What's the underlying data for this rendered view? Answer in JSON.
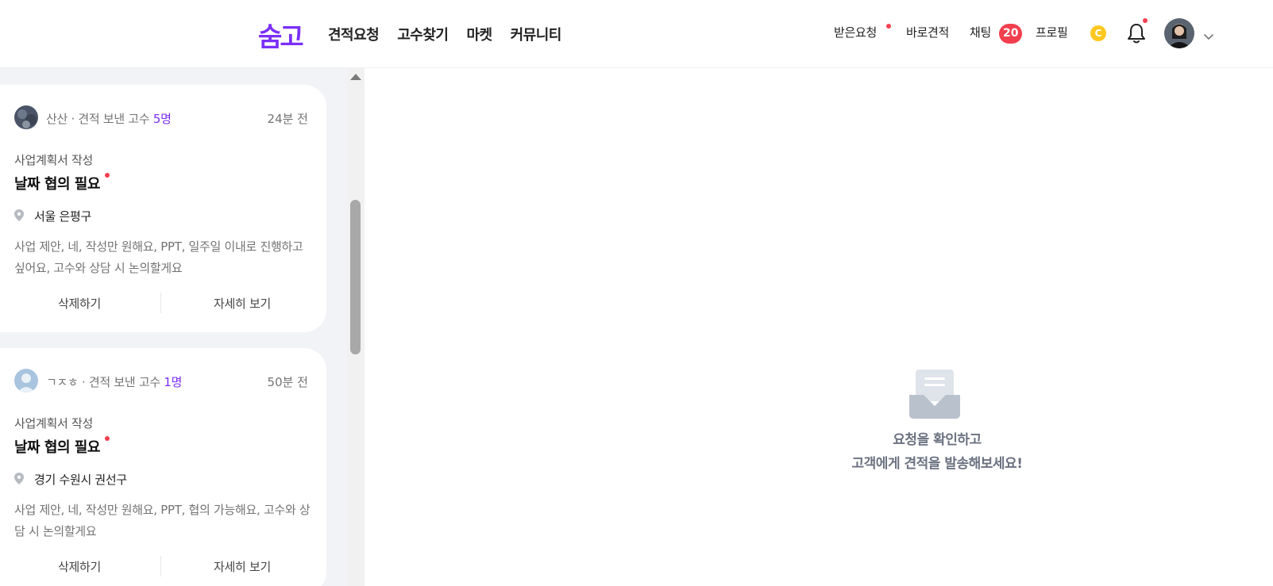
{
  "header": {
    "logo": "숨고",
    "nav": [
      "견적요청",
      "고수찾기",
      "마켓",
      "커뮤니티"
    ],
    "received_requests": "받은요청",
    "quick_quote": "바로견적",
    "chat": "채팅",
    "chat_count": "20",
    "profile": "프로필",
    "coin_label": "C",
    "icons": [
      "bell-icon",
      "avatar",
      "chevron-down-icon",
      "location-pin-icon"
    ]
  },
  "requests": [
    {
      "name": "산산",
      "meta_text": "· 견적 보낸 고수 ",
      "count": "5명",
      "time": "24분 전",
      "category": "사업계획서 작성",
      "title": "날짜 협의 필요",
      "location": "서울 은평구",
      "description": "사업 제안, 네, 작성만 원해요, PPT, 일주일 이내로 진행하고 싶어요, 고수와 상담 시 논의할게요",
      "delete_label": "삭제하기",
      "view_label": "자세히 보기"
    },
    {
      "name": "ㄱㅈㅎ",
      "meta_text": "· 견적 보낸 고수 ",
      "count": "1명",
      "time": "50분 전",
      "category": "사업계획서 작성",
      "title": "날짜 협의 필요",
      "location": "경기 수원시 권선구",
      "description": "사업 제안, 네, 작성만 원해요, PPT, 협의 가능해요, 고수와 상담 시 논의할게요",
      "delete_label": "삭제하기",
      "view_label": "자세히 보기"
    }
  ],
  "empty_state": {
    "line1": "요청을 확인하고",
    "line2": "고객에게 견적을 발송해보세요!"
  },
  "colors": {
    "brand": "#7b2ff7",
    "badge": "#f23f4e",
    "coin": "#ffc81e",
    "list_bg": "#f2f3f6"
  }
}
